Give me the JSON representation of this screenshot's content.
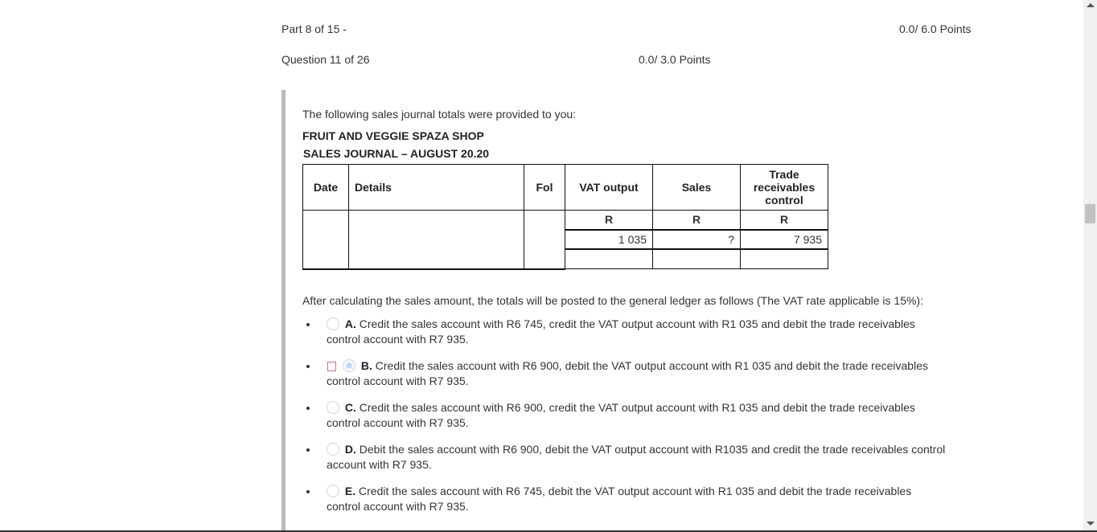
{
  "header": {
    "part_label": "Part 8 of 15 -",
    "part_points": "0.0/ 6.0 Points",
    "question_label": "Question 11 of 26",
    "question_points": "0.0/ 3.0 Points"
  },
  "question": {
    "intro": "The following sales journal totals were provided to you:",
    "shop_name": "FRUIT AND VEGGIE SPAZA SHOP",
    "journal_title": "SALES JOURNAL – AUGUST 20.20",
    "table": {
      "headers": [
        "Date",
        "Details",
        "Fol",
        "VAT output",
        "Sales",
        "Trade receivables control"
      ],
      "currency_row": [
        "R",
        "R",
        "R"
      ],
      "totals": [
        "1 035",
        "?",
        "7 935"
      ]
    },
    "instruction": "After calculating the sales amount, the totals will be posted to the general ledger as follows (The VAT rate applicable is 15%):",
    "options": [
      {
        "letter": "A.",
        "text": "Credit the sales account with R6 745, credit the VAT output account with R1 035 and debit the trade receivables control account with R7 935.",
        "selected": false
      },
      {
        "letter": "B.",
        "text": "Credit the sales account with R6 900, debit the VAT output account with R1 035 and debit the trade receivables control account with R7 935.",
        "selected": true
      },
      {
        "letter": "C.",
        "text": "Credit the sales account with R6 900, credit the VAT output account with R1 035 and debit the trade receivables control account with R7 935.",
        "selected": false
      },
      {
        "letter": "D.",
        "text": "Debit the sales account with R6 900, debit the VAT output account with R1035 and credit the trade receivables control account with R7 935.",
        "selected": false
      },
      {
        "letter": "E.",
        "text": "Credit the sales account with R6 745, debit the VAT output account with R1 035 and debit the trade receivables control account with R7 935.",
        "selected": false
      }
    ]
  },
  "icons": {
    "radio": "radio-button",
    "flag": "incorrect-flag-box",
    "scroll_up": "triangle-up",
    "scroll_down": "triangle-down"
  },
  "colors": {
    "text": "#333333",
    "question_border": "#bbbbbb",
    "selected_radio": "#bcd5f0",
    "flag_border": "#c87a7a"
  }
}
